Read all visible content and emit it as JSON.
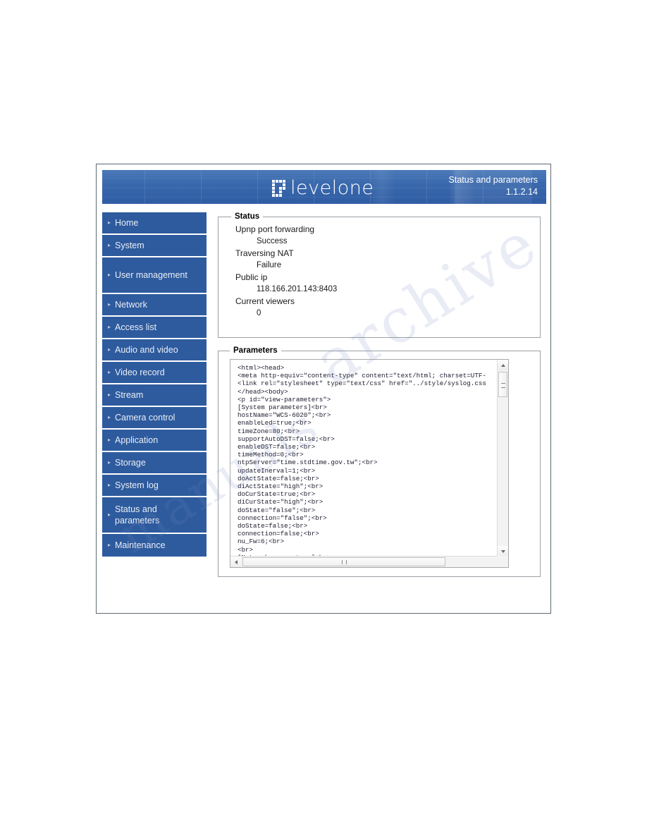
{
  "banner": {
    "logo_text": "levelone",
    "title": "Status and parameters",
    "version": "1.1.2.14"
  },
  "sidebar": {
    "items": [
      {
        "label": "Home",
        "marker": "chevron-right-icon"
      },
      {
        "label": "System",
        "marker": "chevron-right-icon"
      },
      {
        "label": "User management",
        "marker": "chevron-right-icon"
      },
      {
        "label": "Network",
        "marker": "chevron-right-icon"
      },
      {
        "label": "Access list",
        "marker": "chevron-right-icon"
      },
      {
        "label": "Audio and video",
        "marker": "chevron-right-icon"
      },
      {
        "label": "Video record",
        "marker": "chevron-right-icon"
      },
      {
        "label": "Stream",
        "marker": "chevron-right-icon"
      },
      {
        "label": "Camera control",
        "marker": "chevron-right-icon"
      },
      {
        "label": "Application",
        "marker": "chevron-right-icon"
      },
      {
        "label": "Storage",
        "marker": "chevron-right-icon"
      },
      {
        "label": "System log",
        "marker": "chevron-right-icon"
      },
      {
        "label": "Status and parameters",
        "marker": "chevron-right-icon"
      },
      {
        "label": "Maintenance",
        "marker": "chevron-right-icon"
      }
    ],
    "chevron_glyph": "▸"
  },
  "status_panel": {
    "legend": "Status",
    "rows": [
      {
        "label": "Upnp port forwarding",
        "value": "Success"
      },
      {
        "label": "Traversing NAT",
        "value": "Failure"
      },
      {
        "label": "Public ip",
        "value": "118.166.201.143:8403"
      },
      {
        "label": "Current viewers",
        "value": "0"
      }
    ]
  },
  "parameters_panel": {
    "legend": "Parameters",
    "text": "<html><head>\n<meta http-equiv=\"content-type\" content=\"text/html; charset=UTF-\n<link rel=\"stylesheet\" type=\"text/css\" href=\"../style/syslog.css\n</head><body>\n<p id=\"view-parameters\">\n[System parameters]<br>\nhostName=\"WCS-6020\";<br>\nenableLed=true;<br>\ntimeZone=80;<br>\nsupportAutoDST=false;<br>\nenableDST=false;<br>\ntimeMethod=0;<br>\nntpServer=\"time.stdtime.gov.tw\";<br>\nupdateInerval=1;<br>\ndoActState=false;<br>\ndiActState=\"high\";<br>\ndoCurState=true;<br>\ndiCurState=\"high\";<br>\ndoState=\"false\";<br>\nconnection=\"false\";<br>\ndoState=false;<br>\nconnection=false;<br>\nnu_Fw=6;<br>\n<br>\n[Network parameters]<br>\nnetworkType=\"lan\";<br>"
  },
  "scrollbars": {
    "vertical_up": "scroll-up-arrow-icon",
    "vertical_down": "scroll-down-arrow-icon",
    "horizontal_left": "scroll-left-arrow-icon",
    "horizontal_right": "scroll-right-arrow-icon"
  },
  "watermark": {
    "line1": "archive",
    "line2": "manuals"
  }
}
